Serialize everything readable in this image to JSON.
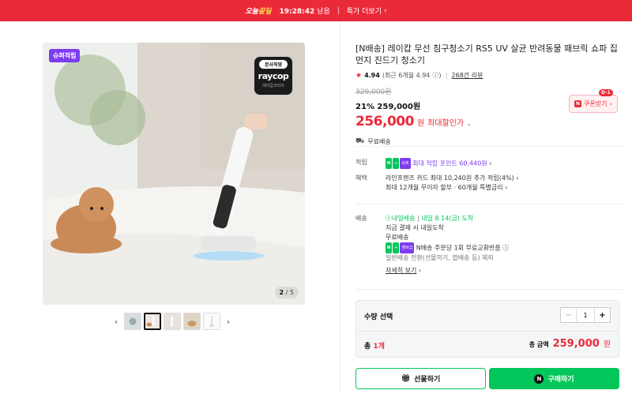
{
  "top_banner": {
    "brand_a": "오늘",
    "brand_b": "끝딜",
    "timer": "19:28:42",
    "timer_suffix": "남음",
    "more_label": "특가 더보기",
    "bg_color": "#eb2a39"
  },
  "gallery": {
    "super_badge": "슈퍼적립",
    "official_label": "본사직영",
    "logo_text": "raycop",
    "logo_sub": "레이캅코리아",
    "counter_current": "2",
    "counter_total": "/ 5",
    "thumbnails": [
      "thumb-1",
      "thumb-2",
      "thumb-3",
      "thumb-4",
      "thumb-5"
    ],
    "active_thumb": 1
  },
  "product": {
    "title": "[N배송] 레이캅 무선 침구청소기 RS5 UV 살균 반려동물 패브릭 쇼파 집먼지 진드기 청소기",
    "rating": "4.94",
    "rating_recent": "(최근 6개월 4.94",
    "review_count": "268건 리뷰",
    "original_price": "329,000원",
    "discount_pct": "21%",
    "sale_price": "259,000원",
    "final_price": "256,000",
    "final_unit": "원",
    "max_discount_label": "최대할인가",
    "coupon_tag": "D-1",
    "coupon_label": "쿠폰받기",
    "shipping": "무료배송"
  },
  "benefits": {
    "points_label": "적립",
    "points_text": "최대 적립 포인트 60,440원",
    "benefit_label": "혜택",
    "benefit_line1": "라인프렌즈 카드 최대 10,240원 추가 적립(4%)",
    "benefit_line2": "최대 12개월 무이자 할부 · 60개월 특별금리"
  },
  "delivery": {
    "label": "배송",
    "badge": "내일배송",
    "arrival": "내일 8.14(금) 도착",
    "line1": "지금 결제 시 내일도착",
    "line2": "무료배송",
    "return_text": "N배송 주문당 1회 무료교환반품",
    "note": "일반배송 전환(선물하기, 합배송 등) 제외",
    "detail_link": "자세히 보기"
  },
  "order": {
    "qty_label": "수량 선택",
    "quantity": "1",
    "total_label_a": "총",
    "total_count": "1개",
    "total_price_label": "총 금액",
    "total_price": "259,000",
    "total_won": "원"
  },
  "actions": {
    "gift_label": "선물하기",
    "buy_label": "구매하기"
  }
}
